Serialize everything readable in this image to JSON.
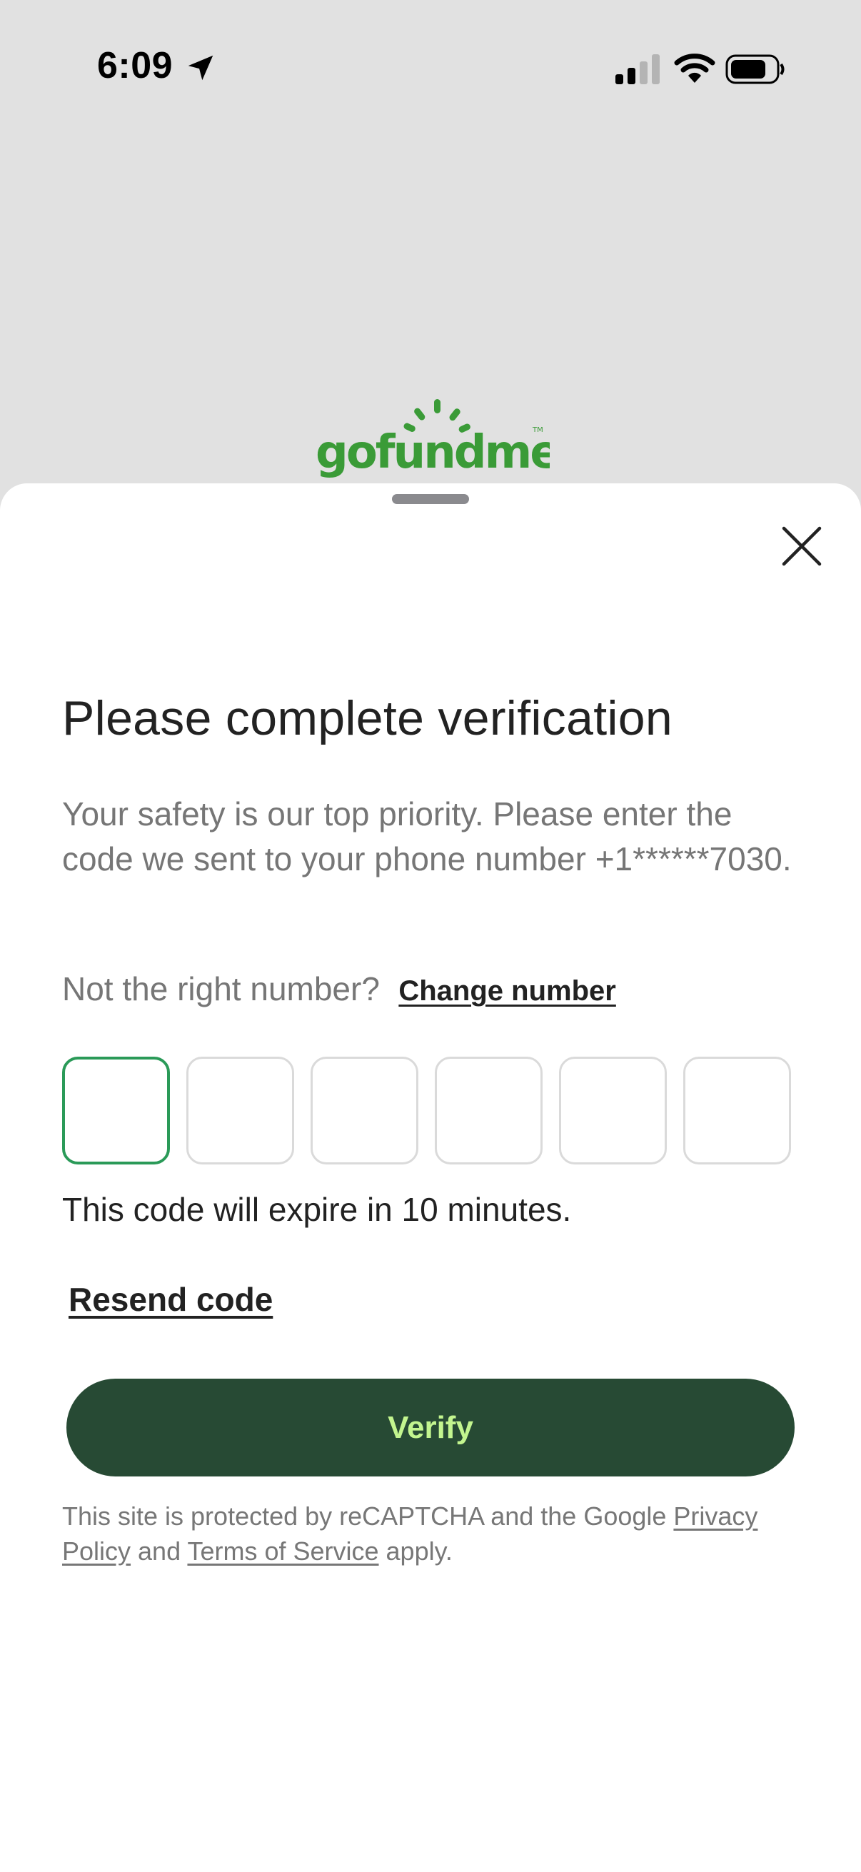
{
  "status_bar": {
    "time": "6:09",
    "icons": [
      "location-arrow-icon",
      "cellular-signal-icon",
      "wifi-icon",
      "battery-icon"
    ]
  },
  "brand": {
    "logo_text": "gofundme",
    "logo_color": "#3a9b37"
  },
  "dialog": {
    "close_icon": "close-icon",
    "title": "Please complete verification",
    "description": "Your safety is our top priority. Please enter the code we sent to your phone number +1******7030.",
    "wrong_number_text": "Not the right number?",
    "change_number_label": "Change number",
    "code_digits": [
      "",
      "",
      "",
      "",
      "",
      ""
    ],
    "expire_text": "This code will expire in 10 minutes.",
    "resend_label": "Resend code",
    "verify_label": "Verify",
    "legal": {
      "prefix": "This site is protected by reCAPTCHA and the Google ",
      "privacy_link": "Privacy Policy",
      "and": " and ",
      "terms_link": "Terms of Service",
      "suffix": " apply."
    }
  },
  "colors": {
    "background": "#e1e1e1",
    "accent_green": "#2a9a58",
    "button_bg": "#274a34",
    "button_text": "#c3f58f",
    "title": "#222222",
    "muted": "#767676"
  }
}
